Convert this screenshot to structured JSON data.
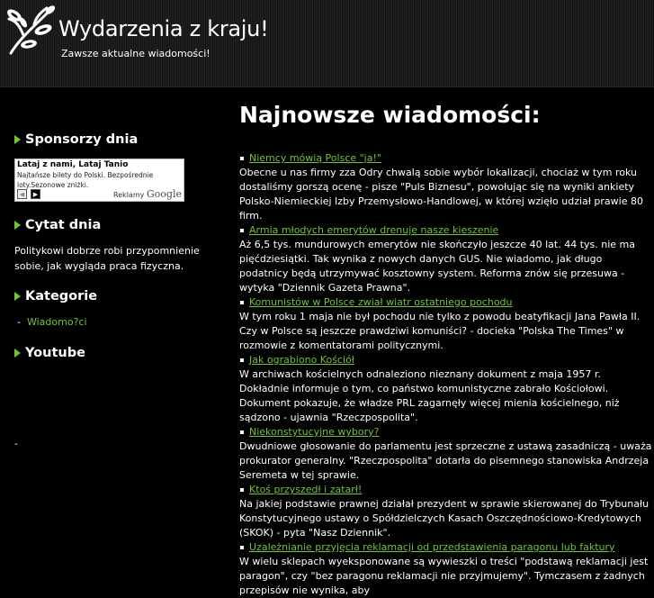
{
  "header": {
    "site_title": "Wydarzenia z kraju!",
    "tagline": "Zawsze aktualne wiadomości!"
  },
  "colors": {
    "accent": "#72c23a",
    "background": "#000000",
    "text": "#ffffff"
  },
  "sidebar": {
    "sponsors": {
      "heading": "Sponsorzy dnia",
      "ad": {
        "title": "Lataj z nami, Lataj Tanio",
        "text": "Najtańsze bilety do Polski. Bezpośrednie loty.Sezonowe zniżki.",
        "prev_label": "◀",
        "next_label": "▶",
        "label": "Reklamy",
        "brand": "Google"
      }
    },
    "quote": {
      "heading": "Cytat dnia",
      "text": "Politykowi dobrze robi przypomnienie sobie, jak wygląda praca fizyczna."
    },
    "categories": {
      "heading": "Kategorie",
      "items": [
        {
          "bullet": "-",
          "label": "Wiadomo?ci"
        }
      ]
    },
    "youtube": {
      "heading": "Youtube",
      "content": "-"
    }
  },
  "main": {
    "title": "Najnowsze wiadomości:",
    "news": [
      {
        "title": "Niemcy mówią Polsce \"ja!\"",
        "text": "Obecne u nas firmy zza Odry chwalą sobie wybór lokalizacji, chociaż w tym roku dostaliśmy gorszą ocenę - pisze \"Puls Biznesu\", powołując się na wyniki ankiety Polsko-Niemieckiej Izby Przemysłowo-Handlowej, w której wzięło udział prawie 80 firm."
      },
      {
        "title": "Armia młodych emerytów drenuje nasze kieszenie",
        "text": "Aż 6,5 tys. mundurowych emerytów nie skończyło jeszcze 40 lat. 44 tys. nie ma pięćdziesiątki. Tak wynika z nowych danych GUS. Nie wiadomo, jak długo podatnicy będą utrzymywać kosztowny system. Reforma znów się przesuwa - wytyka \"Dziennik Gazeta Prawna\"."
      },
      {
        "title": "Komunistów w Polsce zwiał wiatr ostatniego pochodu",
        "text": "W tym roku 1 maja nie był pochodu nie tylko z powodu beatyfikacji Jana Pawła II. Czy w Polsce są jeszcze prawdziwi komuniści? - docieka \"Polska The Times\" w rozmowie z komentatorami politycznymi."
      },
      {
        "title": "Jak ograbiono Kościół",
        "text": "W archiwach kościelnych odnaleziono nieznany dokument z maja 1957 r. Dokładnie informuje o tym, co państwo komunistyczne zabrało Kościołowi. Dokument pokazuje, że władze PRL zagarnęły więcej mienia kościelnego, niż sądzono - ujawnia \"Rzeczpospolita\"."
      },
      {
        "title": "Niekonstytucyjne wybory?",
        "text": "Dwudniowe głosowanie do parlamentu jest sprzeczne z ustawą zasadniczą - uważa prokurator generalny. \"Rzeczpospolita\" dotarła do pisemnego stanowiska Andrzeja Seremeta w tej sprawie."
      },
      {
        "title": "Ktoś przyszedł i zatarł!",
        "text": "Na jakiej podstawie prawnej działał prezydent w sprawie skierowanej do Trybunału Konstytucyjnego ustawy o Spółdzielczych Kasach Oszczędnościowo-Kredytowych (SKOK) - pyta \"Nasz Dziennik\"."
      },
      {
        "title": "Uzależnianie przyjęcia reklamacji od przedstawienia paragonu lub faktury",
        "text": "W wielu sklepach wyeksponowane są wywieszki o treści \"podstawą reklamacji jest paragon\", czy \"bez paragonu reklamacji nie przyjmujemy\". Tymczasem z żadnych przepisów nie wynika, aby"
      }
    ]
  }
}
